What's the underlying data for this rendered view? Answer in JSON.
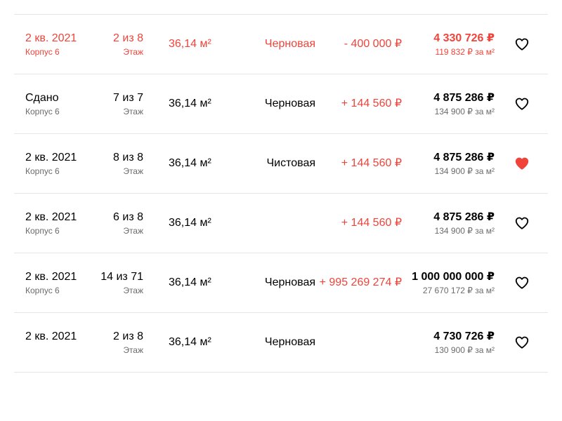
{
  "colors": {
    "accent_red": "#f0433a",
    "positive_green": "#14a33c",
    "text_secondary": "#6b6b6b",
    "divider": "#e6e6e6"
  },
  "icons": {
    "favorite_outline": "heart-outline-icon",
    "favorite_filled": "heart-filled-icon"
  },
  "rows": [
    {
      "date": "2 кв. 2021",
      "building": "Корпус 6",
      "floor": "2 из 8",
      "floor_label": "Этаж",
      "area": "36,14 м²",
      "finish": "Черновая",
      "diff": "- 400 000 ₽",
      "diff_dir": "down",
      "price": "4 330 726 ₽",
      "price_per_m": "119 832 ₽ за м²",
      "highlight": true,
      "favorite": false
    },
    {
      "date": "Сдано",
      "building": "Корпус 6",
      "floor": "7 из 7",
      "floor_label": "Этаж",
      "area": "36,14 м²",
      "finish": "Черновая",
      "diff": "+ 144 560 ₽",
      "diff_dir": "up",
      "price": "4 875 286 ₽",
      "price_per_m": "134 900 ₽ за м²",
      "highlight": false,
      "favorite": false
    },
    {
      "date": "2 кв. 2021",
      "building": "Корпус 6",
      "floor": "8 из 8",
      "floor_label": "Этаж",
      "area": "36,14 м²",
      "finish": "Чистовая",
      "diff": "+ 144 560 ₽",
      "diff_dir": "up",
      "price": "4 875 286 ₽",
      "price_per_m": "134 900 ₽ за м²",
      "highlight": false,
      "favorite": true
    },
    {
      "date": "2 кв. 2021",
      "building": "Корпус 6",
      "floor": "6 из 8",
      "floor_label": "Этаж",
      "area": "36,14 м²",
      "finish": "",
      "diff": "+ 144 560 ₽",
      "diff_dir": "up",
      "price": "4 875 286 ₽",
      "price_per_m": "134 900 ₽ за м²",
      "highlight": false,
      "favorite": false
    },
    {
      "date": "2 кв. 2021",
      "building": "Корпус 6",
      "floor": "14 из 71",
      "floor_label": "Этаж",
      "area": "36,14 м²",
      "finish": "Черновая",
      "diff": "+ 995 269 274 ₽",
      "diff_dir": "up",
      "price": "1 000 000 000 ₽",
      "price_per_m": "27 670 172 ₽ за м²",
      "highlight": false,
      "favorite": false
    },
    {
      "date": "2 кв. 2021",
      "building": "",
      "floor": "2 из 8",
      "floor_label": "Этаж",
      "area": "36,14 м²",
      "finish": "Черновая",
      "diff": "",
      "diff_dir": "",
      "price": "4 730 726 ₽",
      "price_per_m": "130 900 ₽ за м²",
      "highlight": false,
      "favorite": false
    }
  ]
}
